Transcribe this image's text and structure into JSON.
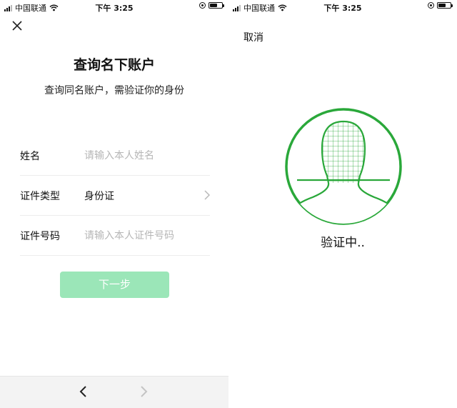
{
  "left_screen": {
    "status_bar": {
      "carrier": "中国联通",
      "time": "下午 3:25",
      "battery_level": 0.55
    },
    "title": "查询名下账户",
    "subtitle": "查询同名账户，需验证你的身份",
    "form": {
      "name": {
        "label": "姓名",
        "placeholder": "请输入本人姓名"
      },
      "id_type": {
        "label": "证件类型",
        "value": "身份证"
      },
      "id_number": {
        "label": "证件号码",
        "placeholder": "请输入本人证件号码"
      }
    },
    "next_label": "下一步"
  },
  "right_screen": {
    "status_bar": {
      "carrier": "中国联通",
      "time": "下午 3:25",
      "battery_level": 0.55
    },
    "cancel_label": "取消",
    "status_text": "验证中..",
    "accent_color": "#2aa83a"
  },
  "colors": {
    "button_disabled": "#9be6b8",
    "bottom_bar": "#f3f3f3",
    "separator": "#ececec",
    "placeholder": "#b6b6b6"
  },
  "icons": [
    "close-icon",
    "chevron-right-icon",
    "back-arrow-icon",
    "forward-arrow-icon",
    "face-scan-icon",
    "wifi-icon",
    "signal-icon",
    "battery-icon",
    "orientation-lock-icon"
  ]
}
